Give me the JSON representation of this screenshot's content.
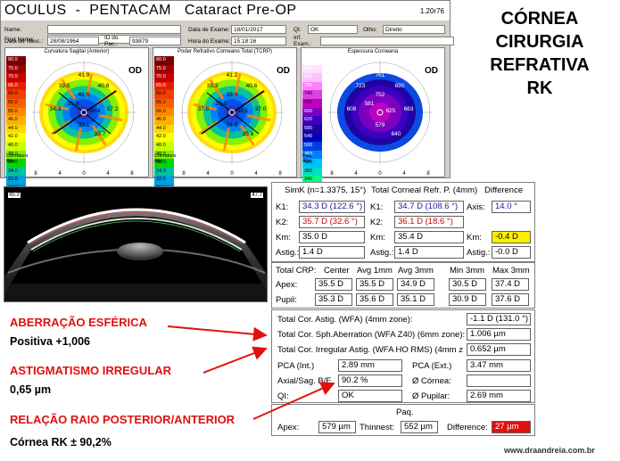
{
  "header": {
    "title": "OCULUS  -  PENTACAM   Cataract Pre-OP",
    "version": "1.20r76",
    "name_label": "Name:",
    "first_name_label": "First Name:",
    "dob_label": "Data de Nasc.:",
    "dob_value": "28/08/1964",
    "id_label": "ID do Pac.:",
    "id_value": "93879",
    "exam_date_label": "Data de Exame:",
    "exam_date_value": "18/01/2017",
    "exam_time_label": "Hora do Exame:",
    "exam_time_value": "15:18:16",
    "qi_label": "QI:",
    "qi_value": "OK",
    "eye_label": "Olho:",
    "eye_value": "Direito",
    "ext_label": "Inf. Exam.:"
  },
  "maps": [
    {
      "title": "Curvatura Sagital (Anterior)",
      "eye": "OD",
      "scale": [
        "80.0",
        "75.0",
        "70.0",
        "65.0",
        "60.0",
        "55.0",
        "50.0",
        "46.0",
        "44.0",
        "42.0",
        "40.0",
        "38.0",
        "36.0",
        "34.0",
        "32.0",
        "30.0",
        "25.0",
        "20.0",
        "15.0",
        "10.0"
      ],
      "caption": [
        "Curvatura",
        "Abs"
      ],
      "axis": [
        "8",
        "4",
        "0",
        "4",
        "8"
      ],
      "values": [
        "41.9",
        "39.5",
        "40.8",
        "34.3",
        "35.3",
        "33.1",
        "36.4",
        "37.2",
        "41.6",
        "35.7"
      ]
    },
    {
      "title": "Poder Refrativo Corneano Total (TCRP)",
      "eye": "OD",
      "scale": [
        "80.0",
        "75.0",
        "70.0",
        "65.0",
        "60.0",
        "55.0",
        "50.0",
        "46.0",
        "44.0",
        "42.0",
        "40.0",
        "38.0",
        "36.0",
        "34.0",
        "32.0",
        "30.0",
        "25.0",
        "20.0",
        "15.0",
        "10.0"
      ],
      "caption": [
        "Curvatura",
        "Abs"
      ],
      "axis": [
        "8",
        "4",
        "0",
        "4",
        "8"
      ],
      "values": [
        "41.2",
        "39.3",
        "40.6",
        "37.5",
        "35.1",
        "34.9",
        "36.1",
        "37.0",
        "33.8",
        "35.6"
      ]
    },
    {
      "title": "Espessura Corneana",
      "eye": "OD",
      "scale": [
        "900",
        "860",
        "820",
        "780",
        "740",
        "700",
        "660",
        "620",
        "580",
        "540",
        "500",
        "460",
        "420",
        "380",
        "340",
        "300",
        "260",
        "220",
        "180",
        "140"
      ],
      "caption": [
        "Paq.",
        "Abs"
      ],
      "axis": [
        "8",
        "4",
        "0",
        "4",
        "8"
      ],
      "values": [
        "761",
        "723",
        "690",
        "608",
        "581",
        "579",
        "625",
        "663",
        "752",
        "640"
      ]
    }
  ],
  "right_header": [
    "CÓRNEA",
    "CIRURGIA",
    "REFRATIVA",
    "RK"
  ],
  "scheimpflug": {
    "left_label": "45.3",
    "right_label": "47.7"
  },
  "simk": {
    "title": "SimK (n=1.3375, 15°)",
    "tcrp_title": "Total Corneal Refr. P. (4mm)",
    "diff_title": "Difference",
    "k1_label": "K1:",
    "k1_value": "34.3 D (122.6 °)",
    "k2_label": "K2:",
    "k2_value": "35.7 D (32.6 °)",
    "km_label": "Km:",
    "km_value": "35.0 D",
    "astig_label": "Astig.:",
    "astig_value": "1.4 D",
    "t_k1_label": "K1:",
    "t_k1_value": "34.7 D (108.6 °)",
    "t_k2_label": "K2:",
    "t_k2_value": "36.1 D (18.6 °)",
    "t_km_label": "Km:",
    "t_km_value": "35.4 D",
    "t_astig_label": "Astig.:",
    "t_astig_value": "1.4 D",
    "axis_label": "Axis:",
    "axis_value": "14.0 °",
    "d_km_label": "Km:",
    "d_km_value": "-0.4 D",
    "d_astig_label": "Astig.:",
    "d_astig_value": "-0.0 D"
  },
  "crp": {
    "columns": [
      "Total CRP:",
      "Center",
      "Avg 1mm",
      "Avg 3mm",
      "Min 3mm",
      "Max 3mm"
    ],
    "rows": [
      {
        "label": "Apex:",
        "values": [
          "35.5 D",
          "35.5 D",
          "34.9 D",
          "30.5 D",
          "37.4 D"
        ]
      },
      {
        "label": "Pupil:",
        "values": [
          "35.3 D",
          "35.6 D",
          "35.1 D",
          "30.9 D",
          "37.6 D"
        ]
      }
    ]
  },
  "wfa": {
    "astig_label": "Total Cor. Astig. (WFA) (4mm zone):",
    "astig_value": "-1.1 D (131.0 °)",
    "sph_label": "Total Cor. Sph.Aberration (WFA Z40) (6mm zone):",
    "sph_value": "1.006 µm",
    "irr_label": "Total Cor. Irregular Astig. (WFA HO RMS) (4mm z",
    "irr_value": "0.652 µm",
    "pca_int_label": "PCA (Int.)",
    "pca_int_value": "2.89 mm",
    "pca_ext_label": "PCA (Ext.)",
    "pca_ext_value": "3.47 mm",
    "axsag_label": "Axial/Sag. B/F",
    "axsag_value": "90.2 %",
    "cornea_label": "Ø Córnea:",
    "cornea_value": "",
    "qi_label": "QI:",
    "qi_value": "OK",
    "pupil_label": "Ø Pupilar:",
    "pupil_value": "2.69 mm"
  },
  "paq": {
    "title": "Paq.",
    "apex_label": "Apex:",
    "apex_value": "579 µm",
    "thinnest_label": "Thinnest:",
    "thinnest_value": "552 µm",
    "diff_label": "Difference:",
    "diff_value": "27 µm"
  },
  "annotations": {
    "a1_title": "ABERRAÇÃO ESFÉRICA",
    "a1_value": "Positiva  +1,006",
    "a2_title": "ASTIGMATISMO IRREGULAR",
    "a2_value": "0,65 µm",
    "a3_title": "RELAÇÃO RAIO POSTERIOR/ANTERIOR",
    "a3_value": "Córnea  RK  ± 90,2%"
  },
  "watermark": "www.draandreia.com.br",
  "colors": {
    "highlight_yellow": "#ffee00",
    "highlight_red": "#e01010",
    "value_red": "#cc0000",
    "value_blue": "#1a1aa0"
  }
}
